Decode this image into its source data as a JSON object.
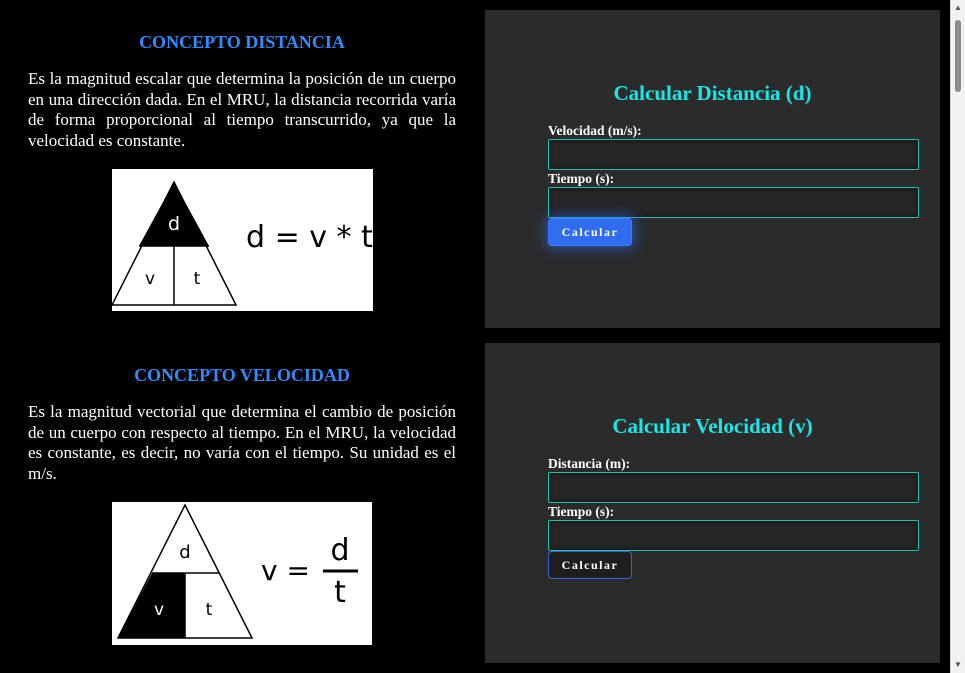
{
  "distance": {
    "concept_title": "CONCEPTO DISTANCIA",
    "concept_text": "Es la magnitud escalar que determina la posición de un cuerpo en una dirección dada. En el MRU, la distancia recorrida varía de forma proporcional al tiempo transcurrido, ya que la velocidad es constante.",
    "figure": {
      "top": "d",
      "left": "v",
      "right": "t",
      "formula": "d = v * t"
    },
    "panel": {
      "title": "Calcular Distancia (d)",
      "field1_label": "Velocidad (m/s):",
      "field1_value": "",
      "field2_label": "Tiempo (s):",
      "field2_value": "",
      "button_label": "Calcular"
    }
  },
  "velocity": {
    "concept_title": "CONCEPTO VELOCIDAD",
    "concept_text": "Es la magnitud vectorial que determina el cambio de posición de un cuerpo con respecto al tiempo. En el MRU, la velocidad es constante, es decir, no varía con el tiempo. Su unidad es el m/s.",
    "figure": {
      "top": "d",
      "left": "v",
      "right": "t",
      "formula_lhs": "v =",
      "numerator": "d",
      "denominator": "t"
    },
    "panel": {
      "title": "Calcular Velocidad (v)",
      "field1_label": "Distancia (m):",
      "field1_value": "",
      "field2_label": "Tiempo (s):",
      "field2_value": "",
      "button_label": "Calcular"
    }
  },
  "colors": {
    "concept_title": "#2f8cff",
    "panel_title": "#19e6e6",
    "panel_bg": "#2b2b2b",
    "input_border": "#1fbfb0",
    "button_primary": "#2f6cf0"
  }
}
